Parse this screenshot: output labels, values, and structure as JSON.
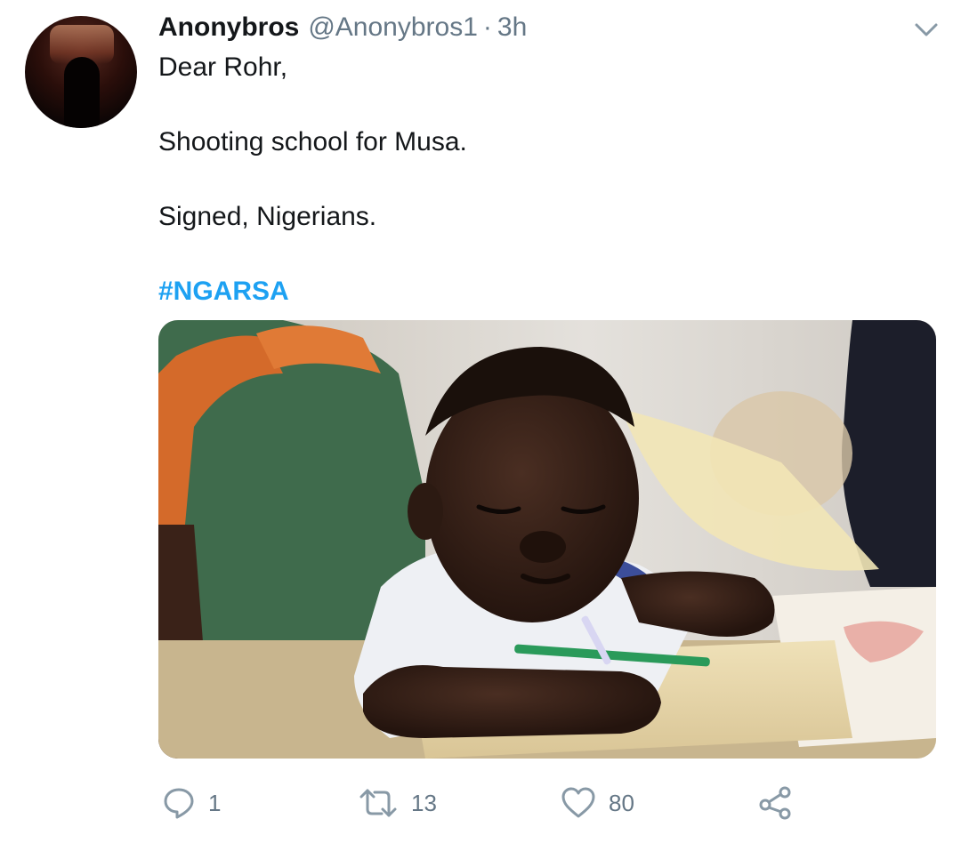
{
  "tweet": {
    "display_name": "Anonybros",
    "handle": "@Anonybros1",
    "separator": "·",
    "time": "3h",
    "lines": [
      "Dear Rohr,",
      "Shooting school for Musa.",
      "Signed, Nigerians."
    ],
    "hashtag": "#NGARSA"
  },
  "actions": {
    "reply_count": "1",
    "retweet_count": "13",
    "like_count": "80"
  },
  "icons": {
    "menu": "chevron-down-icon",
    "reply": "reply-icon",
    "retweet": "retweet-icon",
    "like": "heart-icon",
    "share": "share-icon"
  },
  "colors": {
    "text": "#14171a",
    "secondary": "#657786",
    "link": "#1da1f2",
    "icon": "#8899a6"
  }
}
